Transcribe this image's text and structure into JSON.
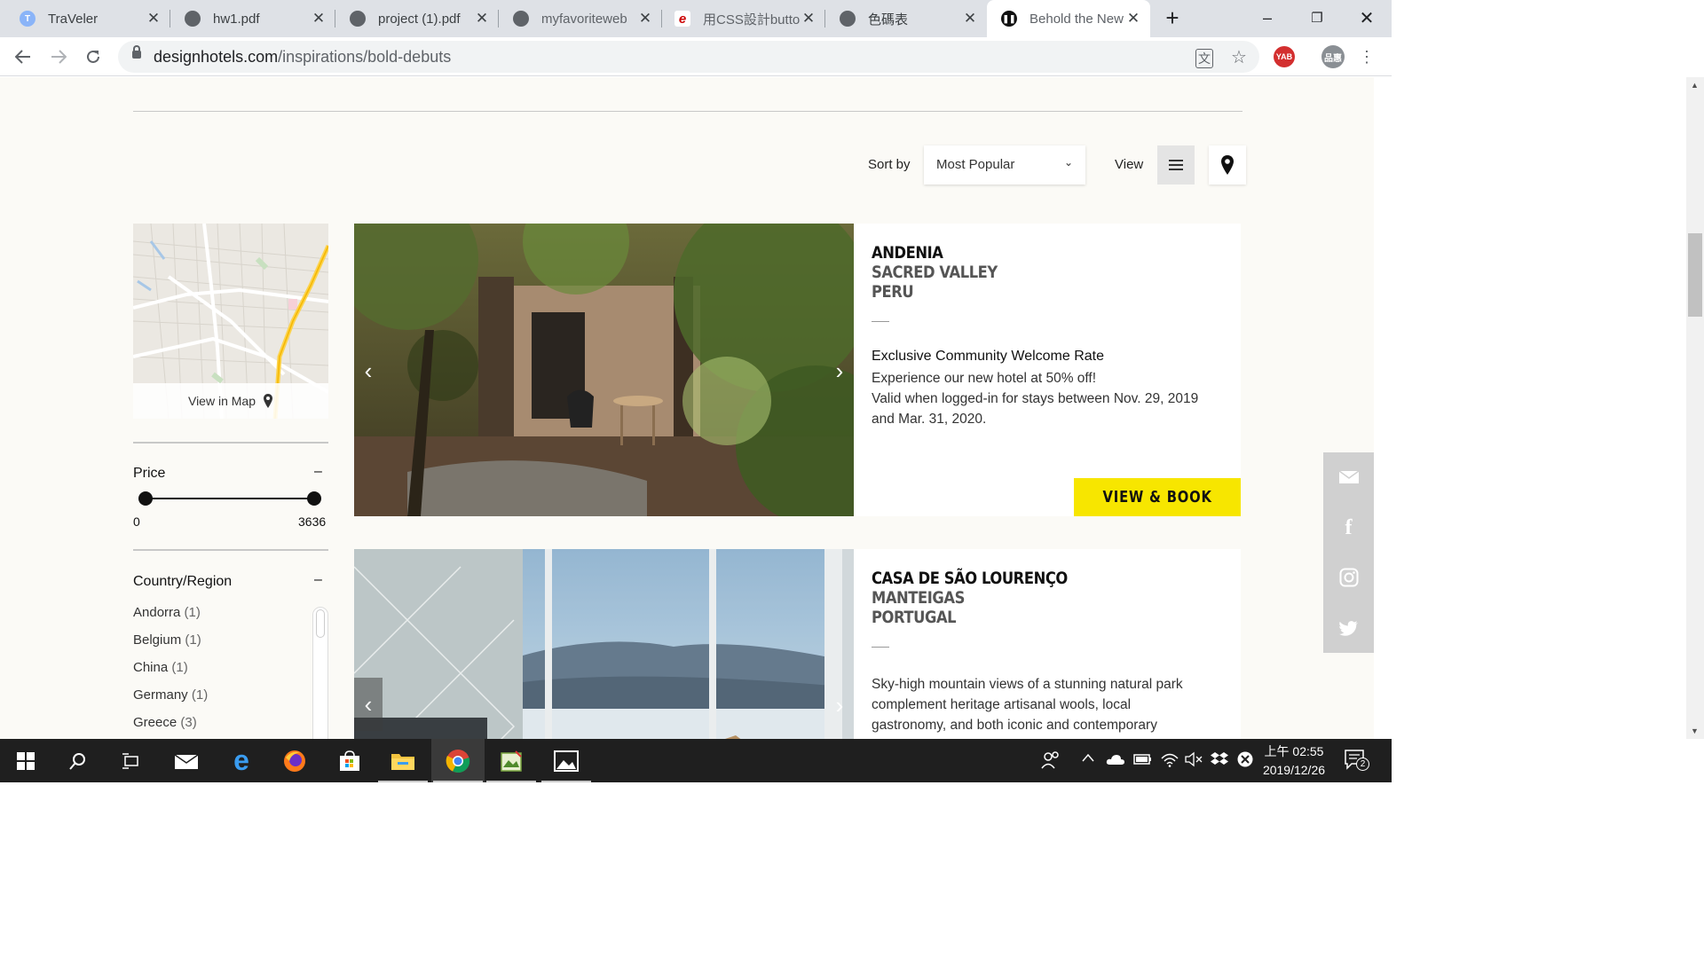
{
  "browser": {
    "tabs": [
      {
        "title": "TraVeler",
        "favicon": "T"
      },
      {
        "title": "hw1.pdf"
      },
      {
        "title": "project (1).pdf"
      },
      {
        "title": "myfavoriteweb"
      },
      {
        "title": "用CSS設計butto"
      },
      {
        "title": "色碼表"
      },
      {
        "title": "Behold the New"
      }
    ],
    "address": {
      "host": "designhotels.com",
      "path": "/inspirations/bold-debuts"
    },
    "extension_badge": "YAB",
    "profile_label": "品惠"
  },
  "toolbar": {
    "sort_label": "Sort by",
    "sort_value": "Most Popular",
    "view_label": "View"
  },
  "sidebar": {
    "map_caption": "View in Map",
    "price": {
      "title": "Price",
      "toggle": "–",
      "min": "0",
      "max": "3636",
      "range_low_fraction": 0,
      "range_high_fraction": 1
    },
    "country": {
      "title": "Country/Region",
      "toggle": "–",
      "items": [
        {
          "name": "Andorra",
          "count": "(1)"
        },
        {
          "name": "Belgium",
          "count": "(1)"
        },
        {
          "name": "China",
          "count": "(1)"
        },
        {
          "name": "Germany",
          "count": "(1)"
        },
        {
          "name": "Greece",
          "count": "(3)"
        }
      ]
    }
  },
  "hotels": [
    {
      "name": "ANDENIA",
      "region": "SACRED VALLEY",
      "country": "PERU",
      "offer_title": "Exclusive Community Welcome Rate",
      "description": "Experience our new hotel at 50% off!\nValid when logged-in for stays between Nov. 29, 2019 and Mar. 31, 2020.",
      "cta": "VIEW & BOOK"
    },
    {
      "name": "CASA DE SÃO LOURENÇO",
      "region": "MANTEIGAS",
      "country": "PORTUGAL",
      "description": "Sky-high mountain views of a stunning natural park complement heritage artisanal wools, local gastronomy, and both iconic and contemporary Portuguese design."
    }
  ],
  "taskbar": {
    "clock_time": "上午 02:55",
    "clock_date": "2019/12/26",
    "notifications": "2"
  },
  "colors": {
    "accent_yellow": "#f7e600",
    "page_bg": "#fbfaf6",
    "taskbar_bg": "#1f1f1f"
  }
}
